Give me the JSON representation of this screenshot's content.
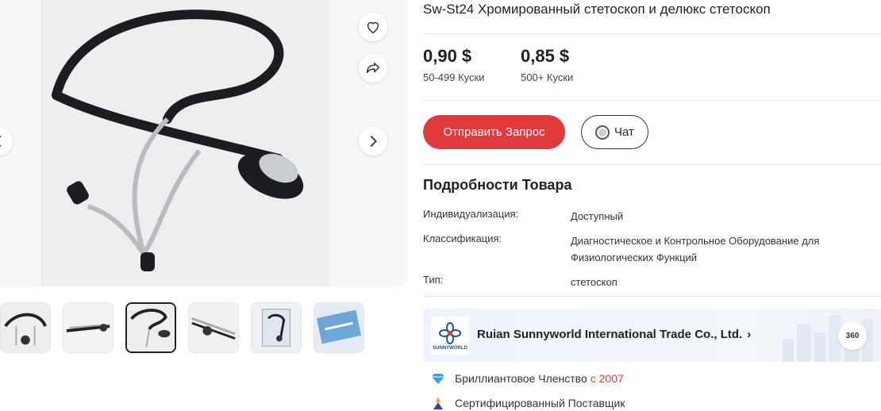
{
  "product": {
    "title": "Sw-St24 Хромированный стетоскоп и делюкс стетоскоп"
  },
  "prices": [
    {
      "price": "0,90 $",
      "range": "50-499 Куски"
    },
    {
      "price": "0,85 $",
      "range": "500+ Куски"
    }
  ],
  "actions": {
    "inquiry_label": "Отправить Запрос",
    "chat_label": "Чат"
  },
  "details": {
    "title": "Подробности Товара",
    "rows": [
      {
        "key": "Индивидуализация:",
        "value": "Доступный"
      },
      {
        "key": "Классификация:",
        "value": "Диагностическое и Контрольное Оборудование для Физиологических Функций"
      },
      {
        "key": "Тип:",
        "value": "стетоскоп"
      }
    ]
  },
  "supplier": {
    "logo_text": "SUNNYWORLD",
    "name": "Ruian Sunnyworld International Trade Co., Ltd.",
    "view_360": "360"
  },
  "badges": {
    "membership_label": "Бриллиантовое Членство",
    "membership_since": "с 2007",
    "certified_label": "Сертифицированный Поставщик"
  },
  "gallery": {
    "thumbnail_count": 6,
    "active_index": 2
  },
  "icons": {
    "favorite": "heart-icon",
    "share": "share-icon",
    "next": "chevron-right-icon",
    "prev": "chevron-left-icon",
    "diamond": "diamond-icon",
    "certified": "certified-icon"
  },
  "colors": {
    "accent": "#e0393e",
    "text": "#222222"
  }
}
